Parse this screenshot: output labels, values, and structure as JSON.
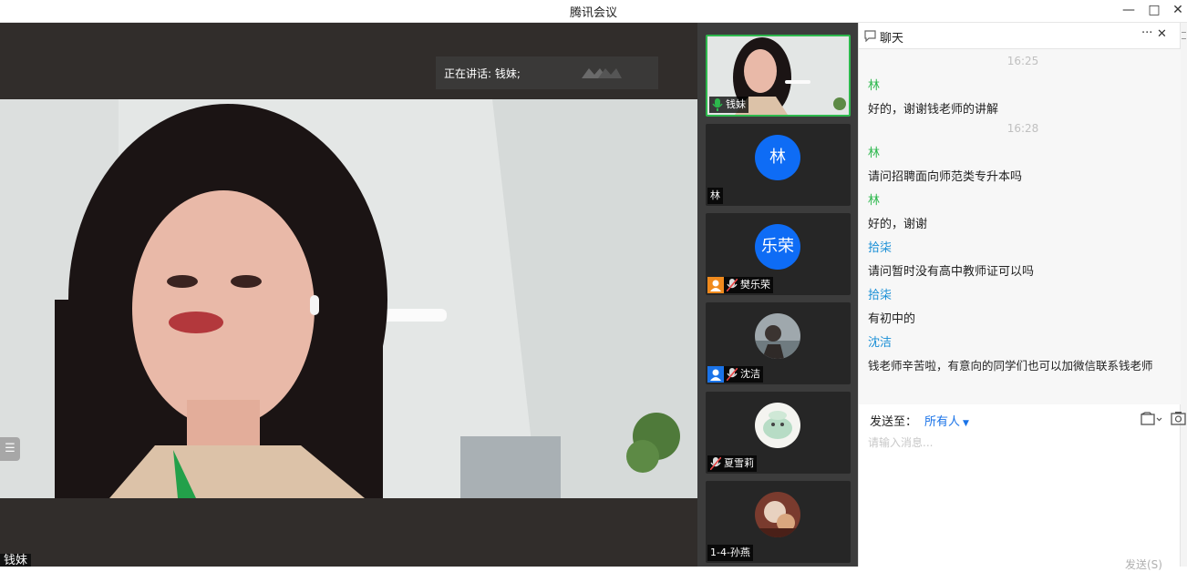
{
  "window": {
    "title": "腾讯会议",
    "minimize": "—",
    "maximize": "□",
    "close": "✕"
  },
  "main_video": {
    "speaking_label": "正在讲话: 钱妹;",
    "speaker_name": "钱妹",
    "side_handle": "☰"
  },
  "participants": [
    {
      "name": "钱妹",
      "avatar_text": "",
      "type": "video",
      "role": "",
      "muted": false,
      "active": true
    },
    {
      "name": "林",
      "avatar_text": "林",
      "type": "avatar",
      "role": "",
      "muted": false,
      "active": false
    },
    {
      "name": "樊乐荣",
      "avatar_text": "乐荣",
      "type": "avatar",
      "role": "host",
      "muted": true,
      "active": false
    },
    {
      "name": "沈洁",
      "avatar_text": "",
      "type": "photo",
      "role": "cohost",
      "muted": true,
      "active": false
    },
    {
      "name": "夏雪莉",
      "avatar_text": "",
      "type": "photo",
      "role": "",
      "muted": true,
      "active": false
    },
    {
      "name": "1-4-孙燕",
      "avatar_text": "",
      "type": "photo",
      "role": "",
      "muted": false,
      "active": false
    }
  ],
  "chat": {
    "title": "聊天",
    "more": "···",
    "close": "✕",
    "messages": [
      {
        "kind": "time",
        "text": "16:25"
      },
      {
        "kind": "sender",
        "text": "林",
        "color": "#2db84d"
      },
      {
        "kind": "text",
        "text": "好的，谢谢钱老师的讲解"
      },
      {
        "kind": "time",
        "text": "16:28"
      },
      {
        "kind": "sender",
        "text": "林",
        "color": "#2db84d"
      },
      {
        "kind": "text",
        "text": "请问招聘面向师范类专升本吗"
      },
      {
        "kind": "sender",
        "text": "林",
        "color": "#2db84d"
      },
      {
        "kind": "text",
        "text": "好的，谢谢"
      },
      {
        "kind": "sender",
        "text": "拾柒",
        "color": "#1a8fd6"
      },
      {
        "kind": "text",
        "text": "请问暂时没有高中教师证可以吗"
      },
      {
        "kind": "sender",
        "text": "拾柒",
        "color": "#1a8fd6"
      },
      {
        "kind": "text",
        "text": "有初中的"
      },
      {
        "kind": "sender",
        "text": "沈洁",
        "color": "#1a8fd6"
      },
      {
        "kind": "text",
        "text": "钱老师辛苦啦，有意向的同学们也可以加微信联系钱老师"
      }
    ],
    "send_to_label": "发送至：",
    "send_to_value": "所有人",
    "input_placeholder": "请输入消息...",
    "send_button": "发送(S)"
  }
}
